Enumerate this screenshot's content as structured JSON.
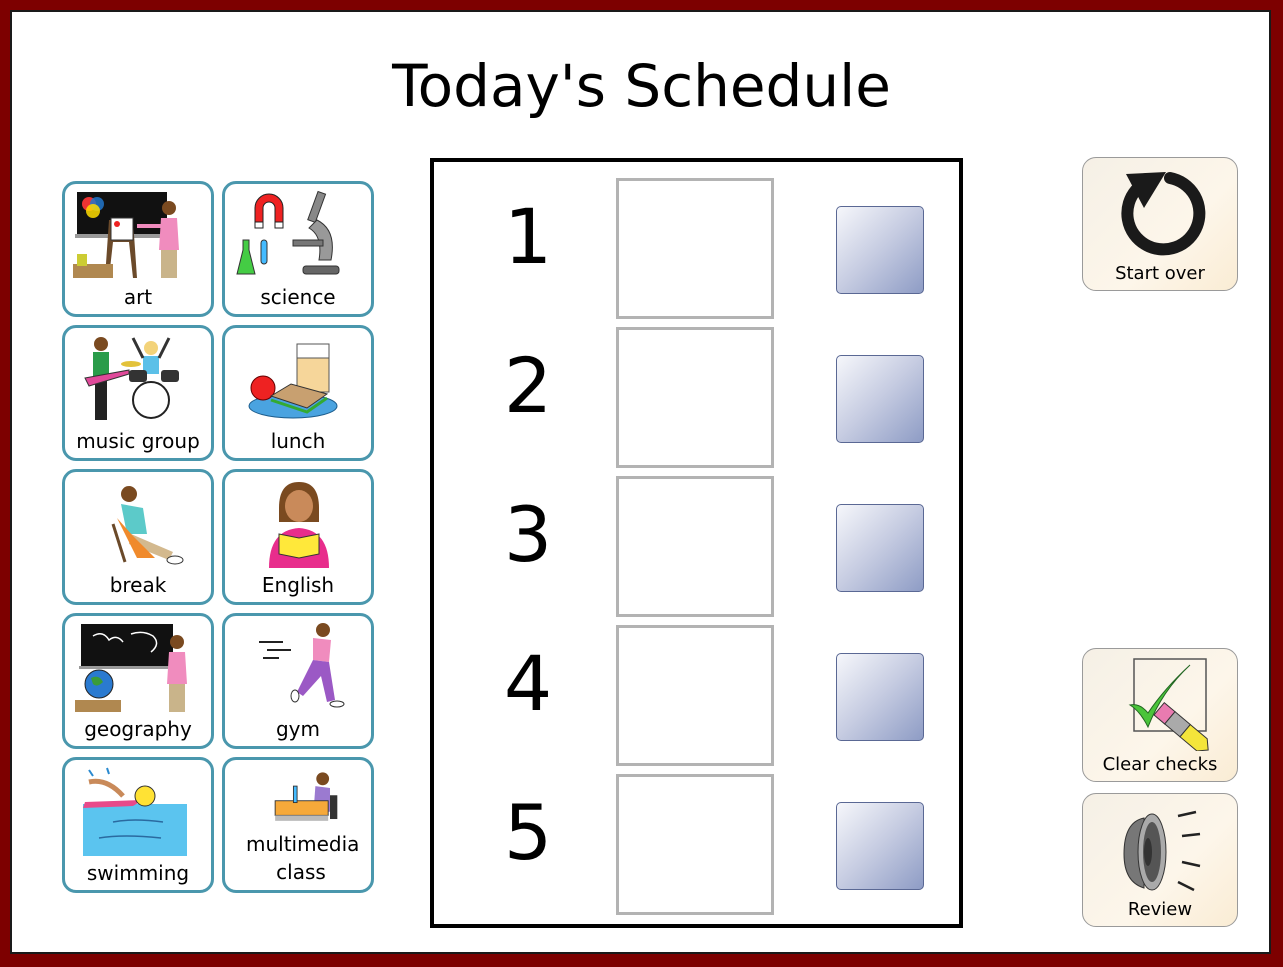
{
  "page": {
    "title": "Today's Schedule"
  },
  "colors": {
    "outer_frame": "#7d0000",
    "tile_border": "#4a97ad",
    "check_box_gradient_end": "#8e9cc5"
  },
  "activities": [
    {
      "label": "art",
      "icon": "art-painting-icon"
    },
    {
      "label": "science",
      "icon": "science-microscope-icon"
    },
    {
      "label": "music group",
      "icon": "music-group-band-icon"
    },
    {
      "label": "lunch",
      "icon": "lunch-sandwich-icon"
    },
    {
      "label": "break",
      "icon": "break-relaxing-icon"
    },
    {
      "label": "English",
      "icon": "english-reading-book-icon"
    },
    {
      "label": "geography",
      "icon": "geography-globe-icon"
    },
    {
      "label": "gym",
      "icon": "gym-running-icon"
    },
    {
      "label": "swimming",
      "icon": "swimming-icon"
    },
    {
      "label": "multimedia class",
      "icon": "multimedia-computer-icon"
    }
  ],
  "schedule": {
    "slots": [
      {
        "number": "1",
        "activity": "",
        "checked": false
      },
      {
        "number": "2",
        "activity": "",
        "checked": false
      },
      {
        "number": "3",
        "activity": "",
        "checked": false
      },
      {
        "number": "4",
        "activity": "",
        "checked": false
      },
      {
        "number": "5",
        "activity": "",
        "checked": false
      }
    ]
  },
  "actions": {
    "start_over": {
      "label": "Start over",
      "icon": "restart-arrow-icon"
    },
    "clear_checks": {
      "label": "Clear checks",
      "icon": "erase-check-icon"
    },
    "review": {
      "label": "Review",
      "icon": "speaker-icon"
    }
  }
}
